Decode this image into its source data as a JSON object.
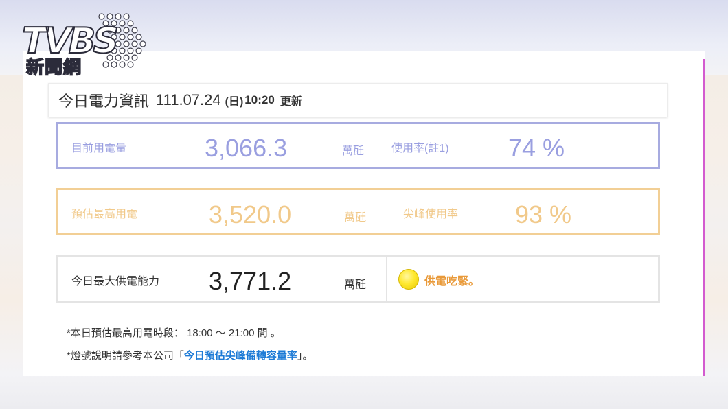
{
  "logo": {
    "text": "TVBS",
    "sub": "新聞網"
  },
  "header": {
    "title": "今日電力資訊",
    "date": "111.07.24",
    "weekday": "(日)",
    "time": "10:20",
    "update_label": "更新"
  },
  "current": {
    "label": "目前用電量",
    "value": "3,066.3",
    "unit": "萬瓩",
    "rate_label": "使用率(註1)",
    "rate": "74 %"
  },
  "forecast": {
    "label": "預估最高用電",
    "value": "3,520.0",
    "unit": "萬瓩",
    "rate_label": "尖峰使用率",
    "rate": "93 %"
  },
  "supply": {
    "label": "今日最大供電能力",
    "value": "3,771.2",
    "unit": "萬瓩",
    "status": "供電吃緊。"
  },
  "notes": {
    "line1": "*本日預估最高用電時段： 18:00 ～ 21:00  間  。",
    "line2_prefix": "*燈號說明請參考本公司「",
    "line2_link": "今日預估尖峰備轉容量率",
    "line2_suffix": "」。"
  },
  "colors": {
    "current": "#9a9fe0",
    "forecast": "#f1c98a",
    "status_light": "#ffe930",
    "status_text": "#e99a3a",
    "link": "#1e7bd6",
    "accent_line": "#d35bcf"
  }
}
